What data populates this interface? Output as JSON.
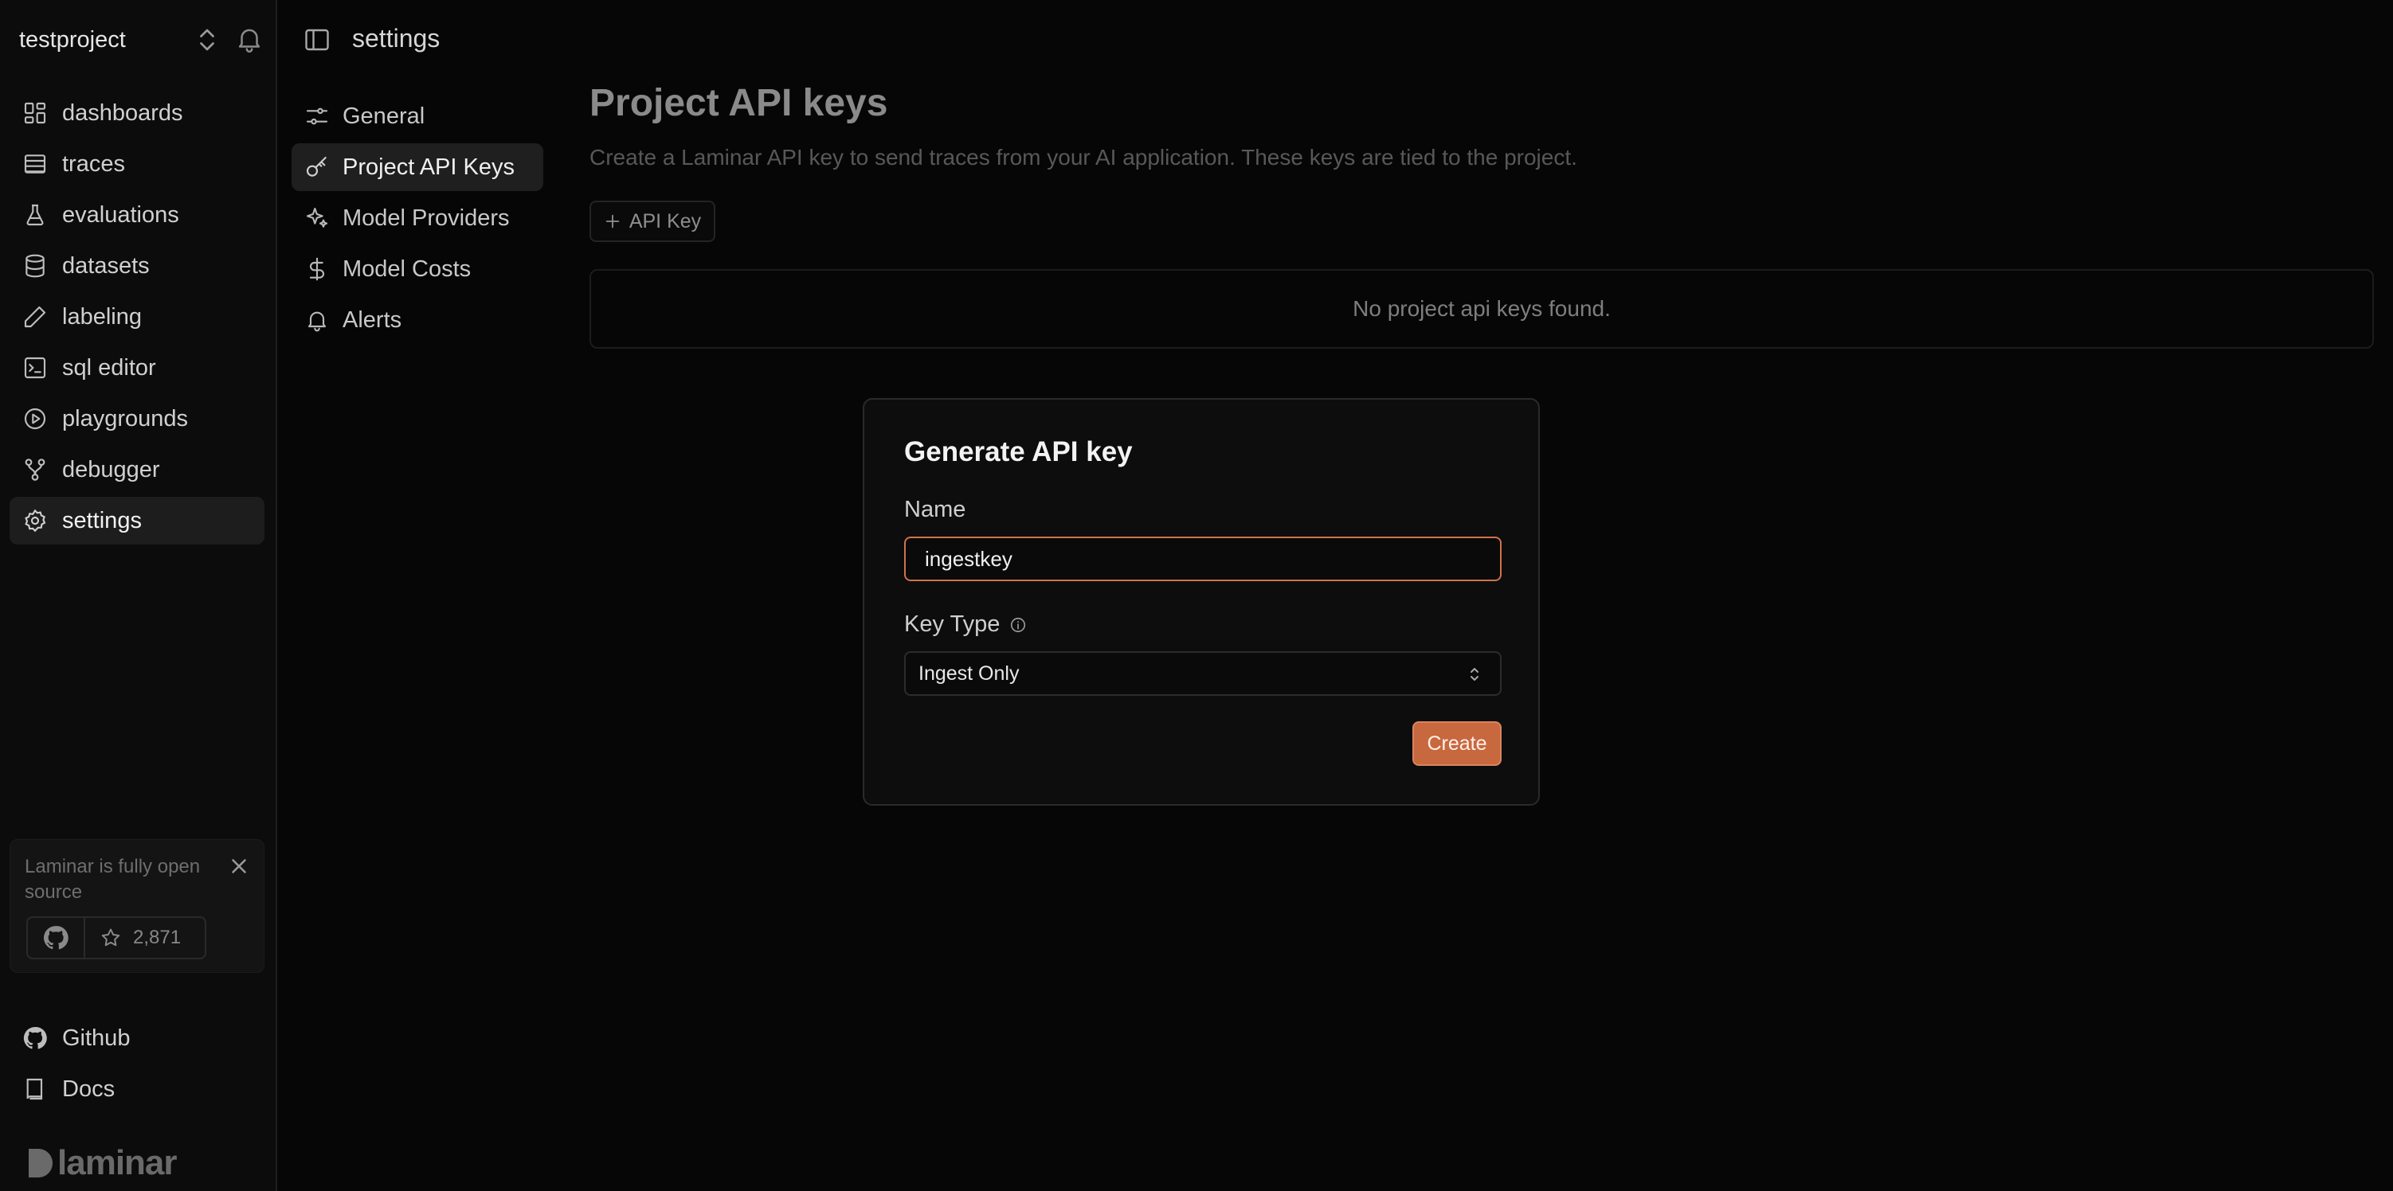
{
  "project": {
    "name": "testproject"
  },
  "nav": {
    "items": [
      {
        "label": "dashboards",
        "icon": "dashboard-icon"
      },
      {
        "label": "traces",
        "icon": "traces-icon"
      },
      {
        "label": "evaluations",
        "icon": "flask-icon"
      },
      {
        "label": "datasets",
        "icon": "database-icon"
      },
      {
        "label": "labeling",
        "icon": "pencil-icon"
      },
      {
        "label": "sql editor",
        "icon": "terminal-icon"
      },
      {
        "label": "playgrounds",
        "icon": "play-icon"
      },
      {
        "label": "debugger",
        "icon": "git-branch-icon"
      },
      {
        "label": "settings",
        "icon": "gear-icon"
      }
    ],
    "active": "settings"
  },
  "oss_card": {
    "text": "Laminar is fully open source",
    "stars": "2,871"
  },
  "footer": {
    "github": "Github",
    "docs": "Docs",
    "logo_text": "laminar"
  },
  "topbar": {
    "title": "settings"
  },
  "subnav": {
    "items": [
      {
        "label": "General",
        "icon": "sliders-icon"
      },
      {
        "label": "Project API Keys",
        "icon": "key-icon"
      },
      {
        "label": "Model Providers",
        "icon": "sparkles-icon"
      },
      {
        "label": "Model Costs",
        "icon": "dollar-icon"
      },
      {
        "label": "Alerts",
        "icon": "bell-icon"
      }
    ],
    "active": "Project API Keys"
  },
  "main": {
    "title": "Project API keys",
    "description": "Create a Laminar API key to send traces from your AI application. These keys are tied to the project.",
    "add_button": "API Key",
    "empty_message": "No project api keys found."
  },
  "modal": {
    "title": "Generate API key",
    "name_label": "Name",
    "name_value": "ingestkey",
    "key_type_label": "Key Type",
    "key_type_value": "Ingest Only",
    "create_button": "Create"
  },
  "colors": {
    "accent": "#c8683f",
    "focus_ring": "#d0734a",
    "background": "#060606"
  }
}
